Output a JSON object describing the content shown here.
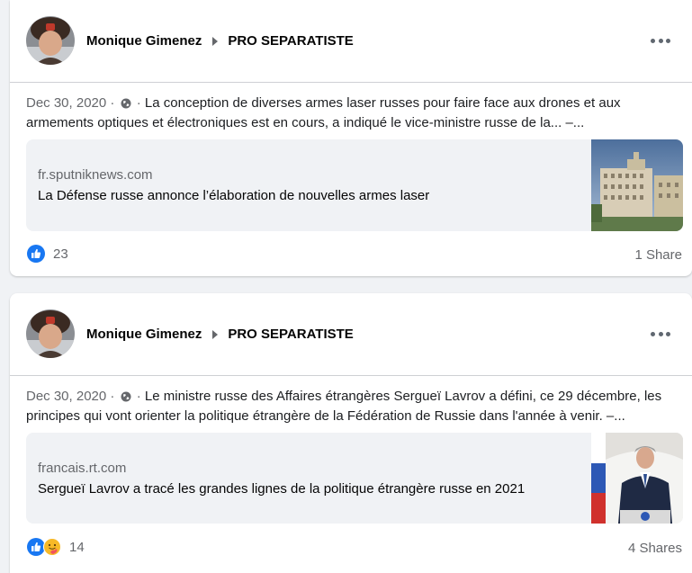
{
  "posts": [
    {
      "author": "Monique Gimenez",
      "group": "PRO SEPARATISTE",
      "date": "Dec 30, 2020",
      "separator": "·",
      "audience_icon": "globe-icon",
      "text": "La conception de diverses armes laser russes pour faire face aux drones et aux armements optiques et électroniques est en cours, a indiqué le vice-ministre russe de la... –...",
      "link": {
        "domain": "fr.sputniknews.com",
        "title": "La Défense russe annonce l’élaboration de nouvelles armes laser"
      },
      "reactions": {
        "icons": [
          "like-icon"
        ],
        "count": "23"
      },
      "shares": "1 Share"
    },
    {
      "author": "Monique Gimenez",
      "group": "PRO SEPARATISTE",
      "date": "Dec 30, 2020",
      "separator": "·",
      "audience_icon": "globe-icon",
      "text": "Le ministre russe des Affaires étrangères Sergueï Lavrov a défini, ce 29 décembre, les principes qui vont orienter la politique étrangère de la Fédération de Russie dans l'année à venir. –...",
      "link": {
        "domain": "francais.rt.com",
        "title": "Sergueï Lavrov a tracé les grandes lignes de la politique étrangère russe en 2021"
      },
      "reactions": {
        "icons": [
          "like-icon",
          "care-icon"
        ],
        "count": "14"
      },
      "shares": "4 Shares"
    }
  ],
  "colors": {
    "background": "#f0f2f5",
    "card": "#ffffff",
    "secondary_text": "#65676b",
    "like_blue": "#1877f2",
    "care_yellow": "#f7b928"
  }
}
